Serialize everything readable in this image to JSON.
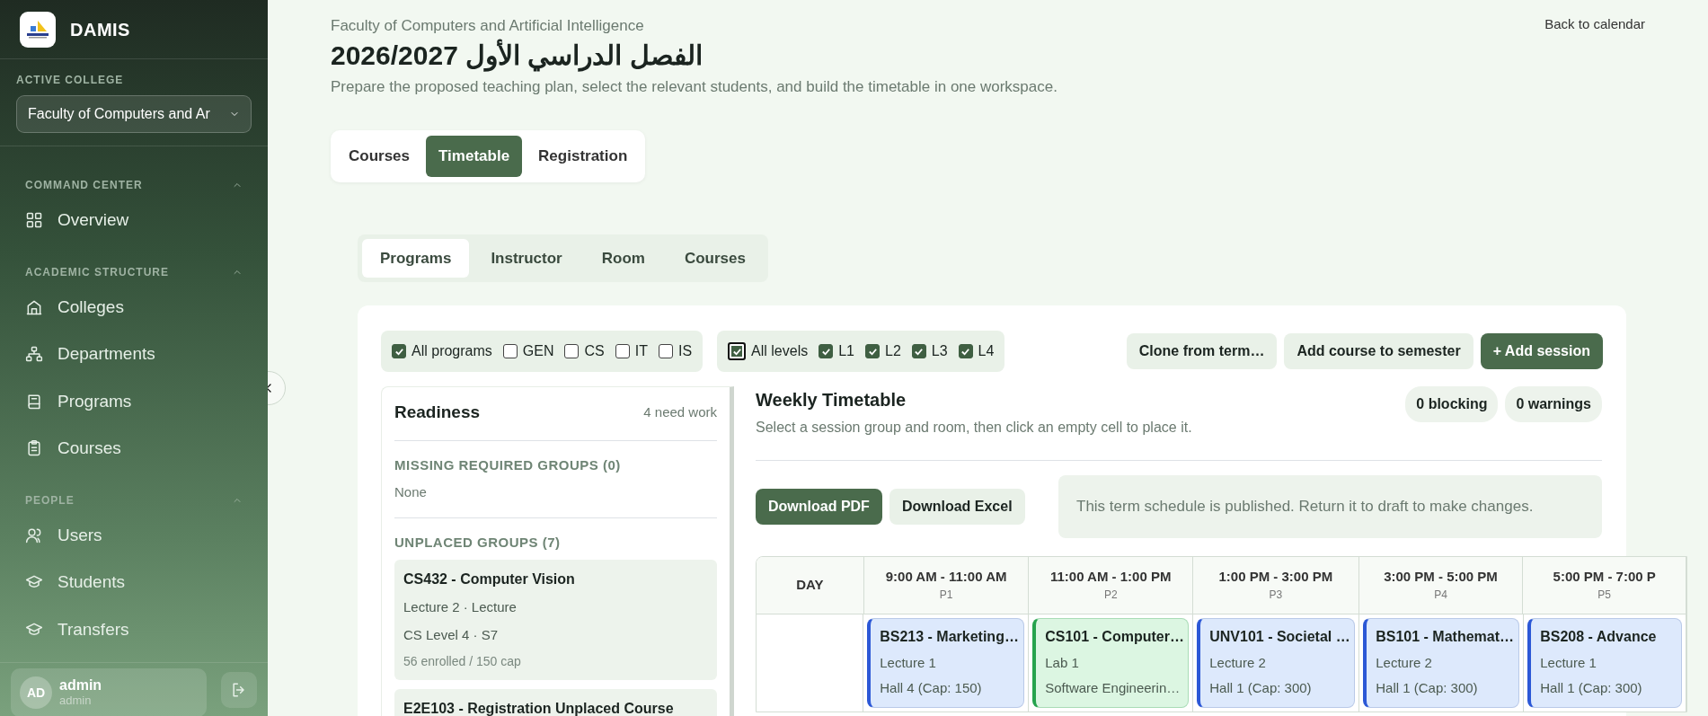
{
  "sidebar": {
    "brand": "DAMIS",
    "college_label": "ACTIVE COLLEGE",
    "college_value": "Faculty of Computers and Ar",
    "sections": [
      {
        "title": "COMMAND CENTER",
        "expanded": true,
        "items": [
          "Overview"
        ]
      },
      {
        "title": "ACADEMIC STRUCTURE",
        "expanded": true,
        "items": [
          "Colleges",
          "Departments",
          "Programs",
          "Courses"
        ]
      },
      {
        "title": "PEOPLE",
        "expanded": true,
        "items": [
          "Users",
          "Students",
          "Transfers"
        ]
      }
    ],
    "user": {
      "initials": "AD",
      "name": "admin",
      "role": "admin"
    }
  },
  "header": {
    "faculty": "Faculty of Computers and Artificial Intelligence",
    "title": "الفصل الدراسي الأول 2026/2027",
    "description": "Prepare the proposed teaching plan, select the relevant students, and build the timetable in one workspace.",
    "back_link": "Back to calendar"
  },
  "tabs": [
    {
      "label": "Courses",
      "selected": false
    },
    {
      "label": "Timetable",
      "selected": true
    },
    {
      "label": "Registration",
      "selected": false
    }
  ],
  "view_tabs": [
    {
      "label": "Programs",
      "selected": true
    },
    {
      "label": "Instructor",
      "selected": false
    },
    {
      "label": "Room",
      "selected": false
    },
    {
      "label": "Courses",
      "selected": false
    }
  ],
  "program_filters": [
    {
      "label": "All programs",
      "checked": true
    },
    {
      "label": "GEN",
      "checked": false
    },
    {
      "label": "CS",
      "checked": false
    },
    {
      "label": "IT",
      "checked": false
    },
    {
      "label": "IS",
      "checked": false
    }
  ],
  "level_filters": [
    {
      "label": "All levels",
      "checked": true,
      "focused": true
    },
    {
      "label": "L1",
      "checked": true,
      "focused": false
    },
    {
      "label": "L2",
      "checked": true,
      "focused": false
    },
    {
      "label": "L3",
      "checked": true,
      "focused": false
    },
    {
      "label": "L4",
      "checked": true,
      "focused": false
    }
  ],
  "actions": [
    {
      "label": "Clone from term…",
      "kind": "secondary"
    },
    {
      "label": "Add course to semester",
      "kind": "secondary"
    },
    {
      "label": "+ Add session",
      "kind": "primary"
    }
  ],
  "readiness": {
    "title": "Readiness",
    "summary": "4 need work",
    "missing_heading": "MISSING REQUIRED GROUPS (0)",
    "missing_value": "None",
    "unplaced_heading": "UNPLACED GROUPS (7)",
    "unplaced": [
      {
        "title": "CS432 - Computer Vision",
        "lines": [
          "Lecture 2 · Lecture",
          "CS Level 4 · S7"
        ],
        "note": "56 enrolled / 150 cap"
      },
      {
        "title": "E2E103 - Registration Unplaced Course"
      }
    ]
  },
  "timetable": {
    "title": "Weekly Timetable",
    "subtitle": "Select a session group and room, then click an empty cell to place it.",
    "badges": [
      "0 blocking",
      "0 warnings"
    ],
    "downloads": [
      {
        "label": "Download PDF",
        "kind": "primary"
      },
      {
        "label": "Download Excel",
        "kind": "secondary"
      }
    ],
    "notice": "This term schedule is published. Return it to draft to make changes.",
    "day_header": "DAY",
    "periods": [
      {
        "time": "9:00 AM - 11:00 AM",
        "code": "P1"
      },
      {
        "time": "11:00 AM - 1:00 PM",
        "code": "P2"
      },
      {
        "time": "1:00 PM - 3:00 PM",
        "code": "P3"
      },
      {
        "time": "3:00 PM - 5:00 PM",
        "code": "P4"
      },
      {
        "time": "5:00 PM - 7:00 P",
        "code": "P5"
      }
    ],
    "sessions": [
      {
        "title": "BS213 - Marketing…",
        "kind": "lecture",
        "lines": [
          "Lecture 1",
          "Hall 4 (Cap: 150)"
        ]
      },
      {
        "title": "CS101 - Computer…",
        "kind": "lab",
        "lines": [
          "Lab 1",
          "Software Engineerin…"
        ]
      },
      {
        "title": "UNV101 - Societal …",
        "kind": "lecture",
        "lines": [
          "Lecture 2",
          "Hall 1 (Cap: 300)"
        ]
      },
      {
        "title": "BS101 - Mathemat…",
        "kind": "lecture",
        "lines": [
          "Lecture 2",
          "Hall 1 (Cap: 300)"
        ]
      },
      {
        "title": "BS208 - Advance",
        "kind": "lecture",
        "lines": [
          "Lecture 1",
          "Hall 1 (Cap: 300)"
        ]
      }
    ]
  }
}
